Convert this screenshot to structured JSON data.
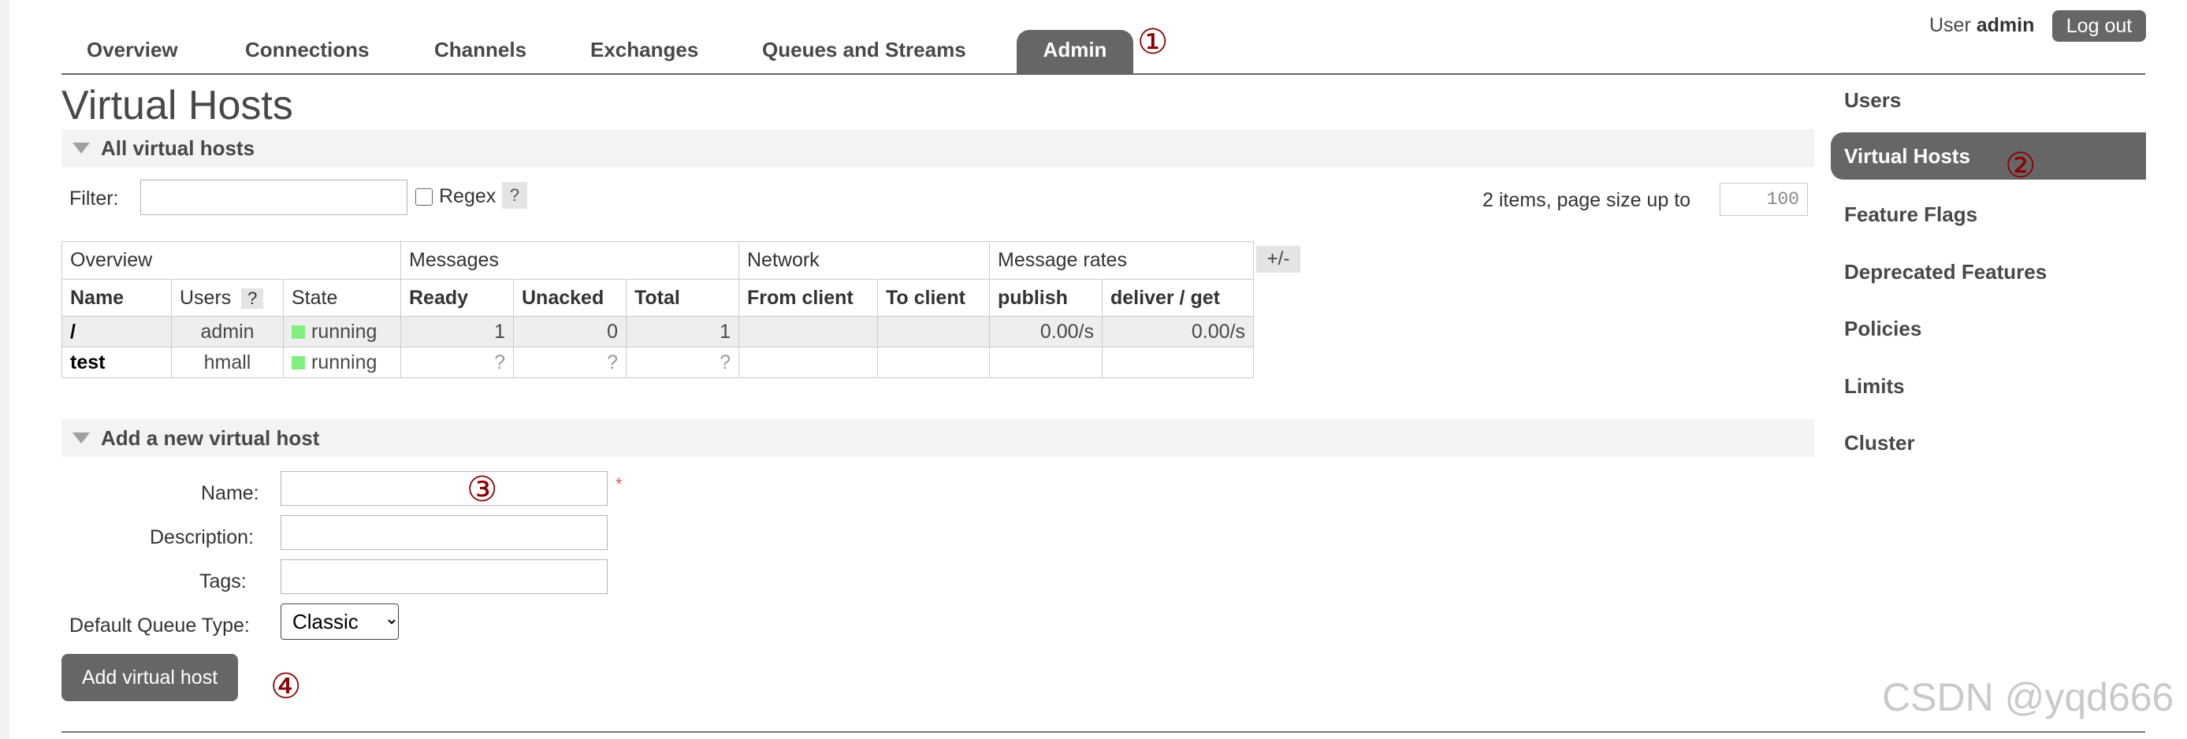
{
  "nav": {
    "tabs": [
      "Overview",
      "Connections",
      "Channels",
      "Exchanges",
      "Queues and Streams",
      "Admin"
    ],
    "active": "Admin"
  },
  "user": {
    "prefix": "User",
    "name": "admin",
    "logout": "Log out"
  },
  "annotations": [
    "①",
    "②",
    "③",
    "④"
  ],
  "page_title": "Virtual Hosts",
  "all_vhosts": {
    "section_title": "All virtual hosts",
    "filter_label": "Filter:",
    "regex_label": "Regex",
    "help": "?",
    "items_text": "2 items, page size up to",
    "page_size": "100",
    "toggle_columns": "+/-",
    "groups": [
      "Overview",
      "Messages",
      "Network",
      "Message rates"
    ],
    "columns": [
      "Name",
      "Users",
      "State",
      "Ready",
      "Unacked",
      "Total",
      "From client",
      "To client",
      "publish",
      "deliver / get"
    ],
    "rows": [
      {
        "name": "/",
        "users": "admin",
        "state": "running",
        "ready": "1",
        "unacked": "0",
        "total": "1",
        "from_client": "",
        "to_client": "",
        "publish": "0.00/s",
        "deliver_get": "0.00/s"
      },
      {
        "name": "test",
        "users": "hmall",
        "state": "running",
        "ready": "?",
        "unacked": "?",
        "total": "?",
        "from_client": "",
        "to_client": "",
        "publish": "",
        "deliver_get": ""
      }
    ]
  },
  "add_vhost": {
    "section_title": "Add a new virtual host",
    "name_label": "Name:",
    "required_mark": "*",
    "description_label": "Description:",
    "tags_label": "Tags:",
    "queue_type_label": "Default Queue Type:",
    "queue_type_value": "Classic",
    "submit": "Add virtual host"
  },
  "sidebar": {
    "items": [
      "Users",
      "Virtual Hosts",
      "Feature Flags",
      "Deprecated Features",
      "Policies",
      "Limits",
      "Cluster"
    ],
    "active": "Virtual Hosts"
  },
  "watermark": "CSDN @yqd666",
  "colors": {
    "accent": "#666666",
    "annotation": "#8b0000",
    "running": "#80f080"
  }
}
